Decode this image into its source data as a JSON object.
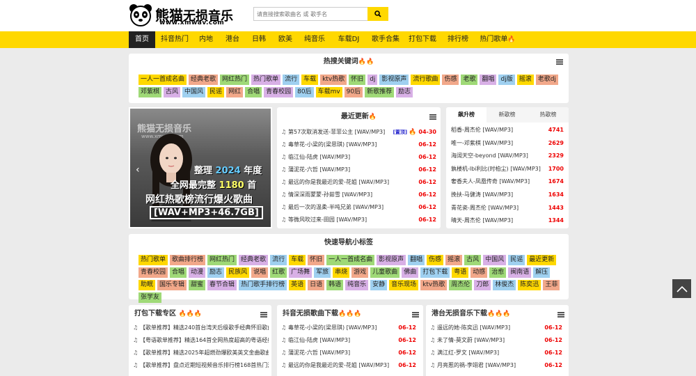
{
  "header": {
    "logo_title_a": "熊猫",
    "logo_title_b": "无损音乐",
    "logo_url": "www.xmwav.com",
    "search_placeholder": "请直接搜索歌曲名 或 歌手名"
  },
  "nav": [
    {
      "label": "首页",
      "active": true
    },
    {
      "label": "抖音热门"
    },
    {
      "label": "内地"
    },
    {
      "label": "港台"
    },
    {
      "label": "日韩"
    },
    {
      "label": "欧美"
    },
    {
      "label": "纯音乐"
    },
    {
      "label": "车载DJ"
    },
    {
      "label": "歌手合集"
    },
    {
      "label": "打包下载"
    },
    {
      "label": "排行榜"
    },
    {
      "label": "热门歌单"
    }
  ],
  "hot_keywords": {
    "title": "热搜关键词",
    "tags": [
      "一人一首成名曲",
      "经典老歌",
      "网红热门",
      "热门歌单",
      "流行",
      "车载",
      "ktv热歌",
      "怀旧",
      "dj",
      "影视原声",
      "流行歌曲",
      "伤感",
      "老歌",
      "翻唱",
      "dj版",
      "摇滚",
      "老歌dj",
      "邓紫棋",
      "古风",
      "中国风",
      "民谣",
      "网红",
      "合唱",
      "青春校园",
      "80后",
      "车载mv",
      "90后",
      "新歌推荐",
      "励志"
    ]
  },
  "banner": {
    "watermark": "熊猫无损音乐",
    "watermark_url": "www.xmwav.com",
    "line1_a": "整理",
    "line1_year": "2024",
    "line1_b": "年度",
    "line2_a": "全网最完整",
    "line2_num": "1180",
    "line2_b": "首",
    "line3": "网红热歌榜流行爆火歌曲",
    "line4": "[WAV+MP3+46.7GB]"
  },
  "recent": {
    "title": "最近更新",
    "items": [
      {
        "title": "第57次取消发送-菲菲公主 [WAV/MP3]",
        "badge": "[置顶]",
        "date": "04-30"
      },
      {
        "title": "毒草花-小梁的(梁思琪) [WAV/MP3]",
        "date": "06-12"
      },
      {
        "title": "临江仙-陆虎 [WAV/MP3]",
        "date": "06-12"
      },
      {
        "title": "蒲泥花-六哲 [WAV/MP3]",
        "date": "06-12"
      },
      {
        "title": "最远的你是我最近的爱-花姐 [WAV/MP3]",
        "date": "06-12"
      },
      {
        "title": "情深深雨蒙蒙-孙茹雪 [WAV/MP3]",
        "date": "06-12"
      },
      {
        "title": "最后一次的温柔-半吨兄弟 [WAV/MP3]",
        "date": "06-12"
      },
      {
        "title": "等微风吹过来-田园 [WAV/MP3]",
        "date": "06-12"
      }
    ]
  },
  "rank": {
    "tabs": [
      "飙升榜",
      "新歌榜",
      "热歌榜"
    ],
    "items": [
      {
        "title": "稻香-周杰伦 [WAV/MP3]",
        "count": "4741"
      },
      {
        "title": "唯一-邓紫棋 [WAV/MP3]",
        "count": "2629"
      },
      {
        "title": "海阔天空-beyond [WAV/MP3]",
        "count": "2329"
      },
      {
        "title": "孰楼机-lbi利比(时柏尘) [WAV/MP3]",
        "count": "1700"
      },
      {
        "title": "奢香夫人-凤凰传奇 [WAV/MP3]",
        "count": "1674"
      },
      {
        "title": "挽扶-马健涛 [WAV/MP3]",
        "count": "1634"
      },
      {
        "title": "青花瓷-周杰伦 [WAV/MP3]",
        "count": "1443"
      },
      {
        "title": "晴天-周杰伦 [WAV/MP3]",
        "count": "1344"
      }
    ]
  },
  "quick_nav": {
    "title": "快速导航小标签",
    "tags": [
      "热门歌单",
      "歌曲排行榜",
      "网红热门",
      "经典老歌",
      "流行",
      "车载",
      "怀旧",
      "一人一首成名曲",
      "影视原声",
      "翻唱",
      "伤感",
      "摇滚",
      "古风",
      "中国风",
      "民谣",
      "最近更新",
      "青春校园",
      "合唱",
      "动漫",
      "励志",
      "民族风",
      "说唱",
      "红歌",
      "广场舞",
      "军旅",
      "串烧",
      "游戏",
      "儿童歌曲",
      "佛曲",
      "打包下载",
      "粤语",
      "动感",
      "治愈",
      "闽南语",
      "解压",
      "助眠",
      "国乐专辑",
      "甜蜜",
      "春节合辑",
      "热门歌手排行榜",
      "英语",
      "日语",
      "韩语",
      "纯音乐",
      "安静",
      "音乐现场",
      "ktv热歌",
      "周杰伦",
      "刀郎",
      "林俊杰",
      "陈奕迅",
      "王菲",
      "张学友"
    ]
  },
  "pack": {
    "title": "打包下载专区",
    "items": [
      "【歌单推荐】精选240首台湾天后级歌手经典怀旧歌曲合",
      "【粤语歌单推荐】精选164首全网热度超高的粤语经典怀",
      "【歌单推荐】精选2025年超燃劲爆欧美英文金曲歌曲194",
      "【歌单推荐】盘点近期短视频音乐排行榜168首热门流行"
    ]
  },
  "douyin": {
    "title": "抖音无损歌曲下载",
    "items": [
      {
        "title": "毒草花-小梁的(梁思琪) [WAV/MP3]",
        "date": "06-12"
      },
      {
        "title": "临江仙-陆虎 [WAV/MP3]",
        "date": "06-12"
      },
      {
        "title": "蒲泥花-六哲 [WAV/MP3]",
        "date": "06-12"
      },
      {
        "title": "最远的你是我最近的爱-花姐 [WAV/MP3]",
        "date": "06-12"
      }
    ]
  },
  "gangtai": {
    "title": "港台无损音乐下载",
    "items": [
      {
        "title": "遥远的她-陈奕迅 [WAV/MP3]",
        "date": "06-12"
      },
      {
        "title": "未了情-莫文蔚 [WAV/MP3]",
        "date": "06-12"
      },
      {
        "title": "满江红-罗文 [WAV/MP3]",
        "date": "06-12"
      },
      {
        "title": "月亮惹的祸-李翊君 [WAV/MP3]",
        "date": "06-12"
      }
    ]
  },
  "colors": {
    "accent": "#ffd800",
    "date_red": "#e00000",
    "tag_colors": [
      "#ffd800",
      "#f2a88a",
      "#9fd977",
      "#d8b0e6",
      "#9fd0f0"
    ]
  }
}
